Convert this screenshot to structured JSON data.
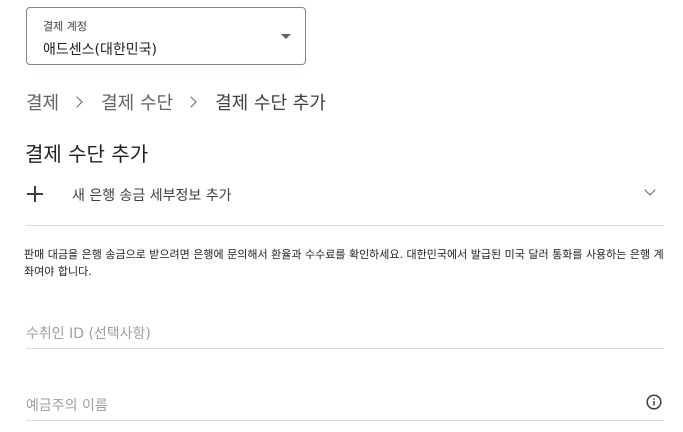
{
  "account_select": {
    "label": "결제 계정",
    "value": "애드센스(대한민국)"
  },
  "breadcrumb": {
    "items": [
      "결제",
      "결제 수단",
      "결제 수단 추가"
    ]
  },
  "page_title": "결제 수단 추가",
  "add_bank": {
    "label": "새 은행 송금 세부정보 추가"
  },
  "info_text": "판매 대금을 은행 송금으로 받으려면 은행에 문의해서 환율과 수수료를 확인하세요. 대한민국에서 발급된 미국 달러 통화를 사용하는 은행 계좌여야 합니다.",
  "fields": {
    "payee_id": {
      "placeholder": "수취인 ID (선택사항)"
    },
    "holder_name": {
      "placeholder": "예금주의 이름"
    }
  },
  "icons": {
    "plus": "plus-icon",
    "chevron": "chevron-down-icon",
    "info": "info-icon",
    "caret": "caret-down-icon"
  }
}
